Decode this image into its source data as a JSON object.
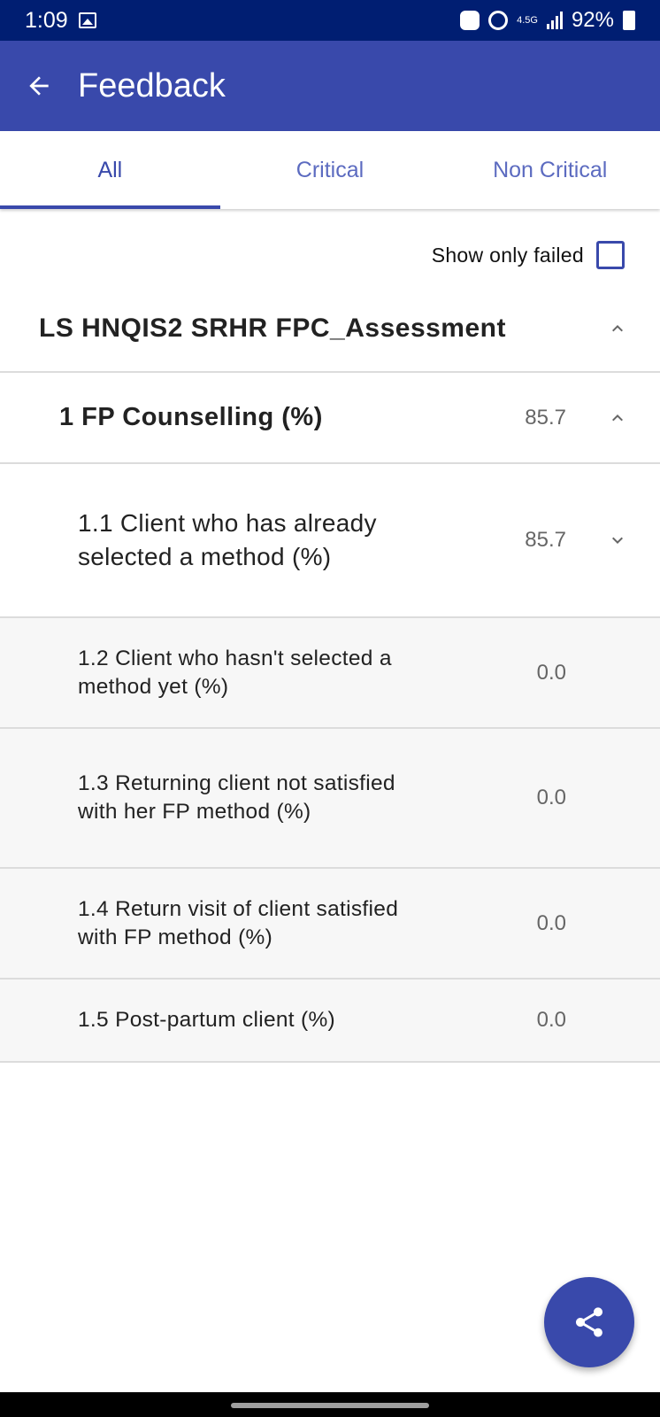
{
  "status_bar": {
    "time": "1:09",
    "network": "4.5G",
    "battery": "92%"
  },
  "app_bar": {
    "title": "Feedback"
  },
  "tabs": [
    {
      "label": "All",
      "active": true
    },
    {
      "label": "Critical",
      "active": false
    },
    {
      "label": "Non Critical",
      "active": false
    }
  ],
  "filter": {
    "label": "Show only failed",
    "checked": false
  },
  "assessment": {
    "title": "LS HNQIS2 SRHR FPC_Assessment"
  },
  "section": {
    "title": "1 FP Counselling (%)",
    "score": "85.7"
  },
  "questions": [
    {
      "label": "1.1 Client who has already selected a method (%)",
      "score": "85.7"
    },
    {
      "label": "1.2 Client who hasn't selected a method yet (%)",
      "score": "0.0"
    },
    {
      "label": "1.3 Returning client not satisfied with her FP method (%)",
      "score": "0.0"
    },
    {
      "label": "1.4 Return visit of client satisfied with FP method (%)",
      "score": "0.0"
    },
    {
      "label": "1.5 Post-partum client (%)",
      "score": "0.0"
    }
  ],
  "colors": {
    "status_bar": "#001e72",
    "primary": "#3949ab",
    "tab_inactive": "#5c6bc0"
  },
  "icons": {
    "back": "arrow-left-icon",
    "share": "share-icon",
    "expand_less": "chevron-up-icon",
    "expand_more": "chevron-down-icon"
  }
}
